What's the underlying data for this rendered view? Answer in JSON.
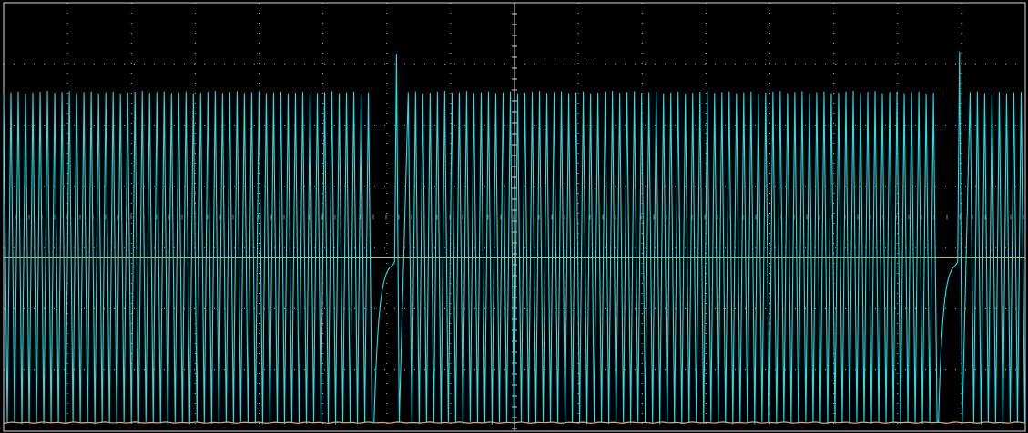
{
  "chart_data": {
    "type": "line",
    "title": "",
    "xlabel": "",
    "ylabel": "",
    "grid": true,
    "grid_divisions": {
      "x": 2,
      "y": 5
    },
    "xlim": [
      0,
      1
    ],
    "ylim": [
      -1,
      1
    ],
    "colors": {
      "background": "#000000",
      "grid": "#d8d8d8",
      "channel_1": "#22e0f0",
      "channel_2": "#f2a673",
      "reference": "#f0f0a0"
    },
    "series": [
      {
        "type": "burst",
        "color_key": "channel_1",
        "offset": -0.21,
        "amplitude_high": 0.58,
        "amplitude_low": -0.96,
        "cycles_per_burst": 50,
        "period": 0.00714,
        "bursts": [
          {
            "start": 0.0,
            "end": 0.3625
          },
          {
            "start": 0.396,
            "end": 0.915
          },
          {
            "start": 0.946,
            "end": 1.0
          }
        ],
        "gaps": [
          {
            "start": 0.3625,
            "end": 0.396,
            "spike": 0.76
          },
          {
            "start": 0.915,
            "end": 0.946,
            "spike": 0.77
          }
        ]
      },
      {
        "type": "flat",
        "color_key": "channel_2",
        "value": -0.96
      },
      {
        "type": "reference",
        "color_key": "reference",
        "value": -0.19
      }
    ]
  }
}
